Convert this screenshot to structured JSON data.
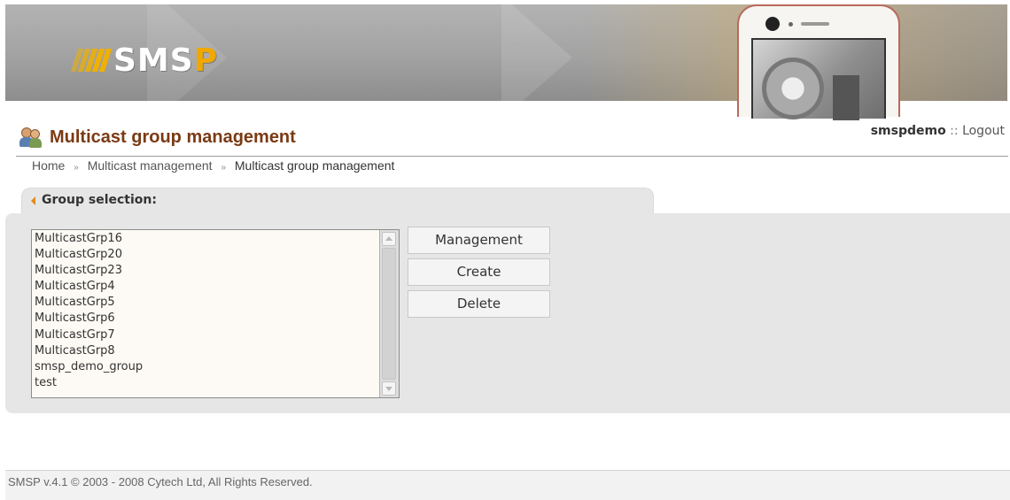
{
  "header": {
    "logo": {
      "prefix": "SMS",
      "accent": "P"
    },
    "brand_color": "#f0a800"
  },
  "page": {
    "title": "Multicast group management",
    "icon": "users-group-icon"
  },
  "user": {
    "name": "smspdemo",
    "separator": "::",
    "logout_label": "Logout"
  },
  "breadcrumb": {
    "separator": "»",
    "items": [
      "Home",
      "Multicast management",
      "Multicast group management"
    ]
  },
  "group_selection": {
    "label": "Group selection:",
    "groups": [
      "MulticastGrp16",
      "MulticastGrp20",
      "MulticastGrp23",
      "MulticastGrp4",
      "MulticastGrp5",
      "MulticastGrp6",
      "MulticastGrp7",
      "MulticastGrp8",
      "smsp_demo_group",
      "test"
    ]
  },
  "actions": {
    "management_label": "Management",
    "create_label": "Create",
    "delete_label": "Delete"
  },
  "footer": {
    "text": "SMSP v.4.1 © 2003 - 2008 Cytech Ltd, All Rights Reserved."
  },
  "colors": {
    "title": "#7a3a14",
    "tab_arrow": "#e28a1c",
    "panel_bg": "#e6e6e6"
  }
}
